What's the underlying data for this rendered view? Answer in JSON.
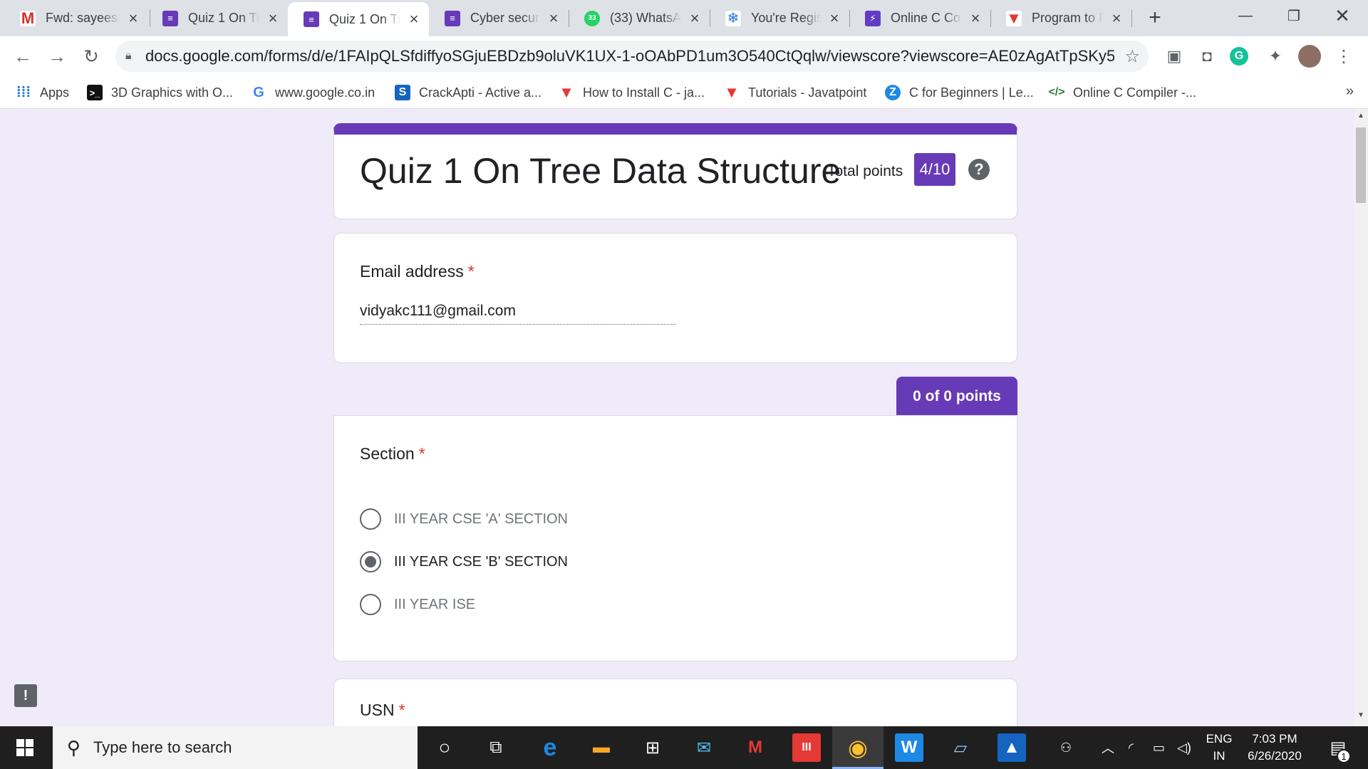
{
  "browser": {
    "tabs": [
      {
        "title": "Fwd: sayeesh",
        "icon": "gmail-icon",
        "active": false
      },
      {
        "title": "Quiz 1 On Tree",
        "icon": "google-forms-icon",
        "active": false
      },
      {
        "title": "Quiz 1 On Tree",
        "icon": "google-forms-icon",
        "active": true
      },
      {
        "title": "Cyber security",
        "icon": "google-forms-icon",
        "active": false
      },
      {
        "title": "(33) WhatsApp",
        "icon": "whatsapp-icon",
        "badge": "33",
        "active": false
      },
      {
        "title": "You're Registered",
        "icon": "snowflake-icon",
        "active": false
      },
      {
        "title": "Online C Compiler",
        "icon": "lightning-icon",
        "active": false
      },
      {
        "title": "Program to Find",
        "icon": "javatpoint-icon",
        "active": false
      }
    ],
    "new_tab_glyph": "+",
    "url": "docs.google.com/forms/d/e/1FAIpQLSfdiffyoSGjuEBDzb9oluVK1UX-1-oOAbPD1um3O540CtQqlw/viewscore?viewscore=AE0zAgAtTpSKy5GpN6...",
    "bookmarks": [
      {
        "label": "Apps",
        "icon": "apps-grid-icon"
      },
      {
        "label": "3D Graphics with O...",
        "icon": "terminal-icon"
      },
      {
        "label": "www.google.co.in",
        "icon": "google-icon"
      },
      {
        "label": "CrackApti - Active a...",
        "icon": "crackapti-icon"
      },
      {
        "label": "How to Install C - ja...",
        "icon": "javatpoint-icon"
      },
      {
        "label": "Tutorials - Javatpoint",
        "icon": "javatpoint-icon"
      },
      {
        "label": "C for Beginners | Le...",
        "icon": "zeta-icon"
      },
      {
        "label": "Online C Compiler -...",
        "icon": "code-icon"
      }
    ],
    "bookmarks_overflow": "»"
  },
  "form": {
    "title": "Quiz 1 On Tree Data Structure",
    "total_points_label": "Total points",
    "score": "4/10",
    "help_glyph": "?",
    "email_question": {
      "label": "Email address",
      "required_mark": "*",
      "value": "vidyakc111@gmail.com"
    },
    "section_points": "0 of 0 points",
    "section_question": {
      "label": "Section",
      "required_mark": "*",
      "options": [
        {
          "label": "III YEAR CSE 'A' SECTION",
          "selected": false
        },
        {
          "label": "III YEAR CSE 'B' SECTION",
          "selected": true
        },
        {
          "label": "III YEAR ISE",
          "selected": false
        }
      ]
    },
    "usn_question": {
      "label": "USN",
      "required_mark": "*"
    },
    "feedback_glyph": "!"
  },
  "taskbar": {
    "search_placeholder": "Type here to search",
    "language_line1": "ENG",
    "language_line2": "IN",
    "time": "7:03 PM",
    "date": "6/26/2020",
    "notification_count": "1"
  },
  "colors": {
    "form_accent": "#673ab7",
    "page_background": "#f0ebf8",
    "required": "#d93025"
  }
}
